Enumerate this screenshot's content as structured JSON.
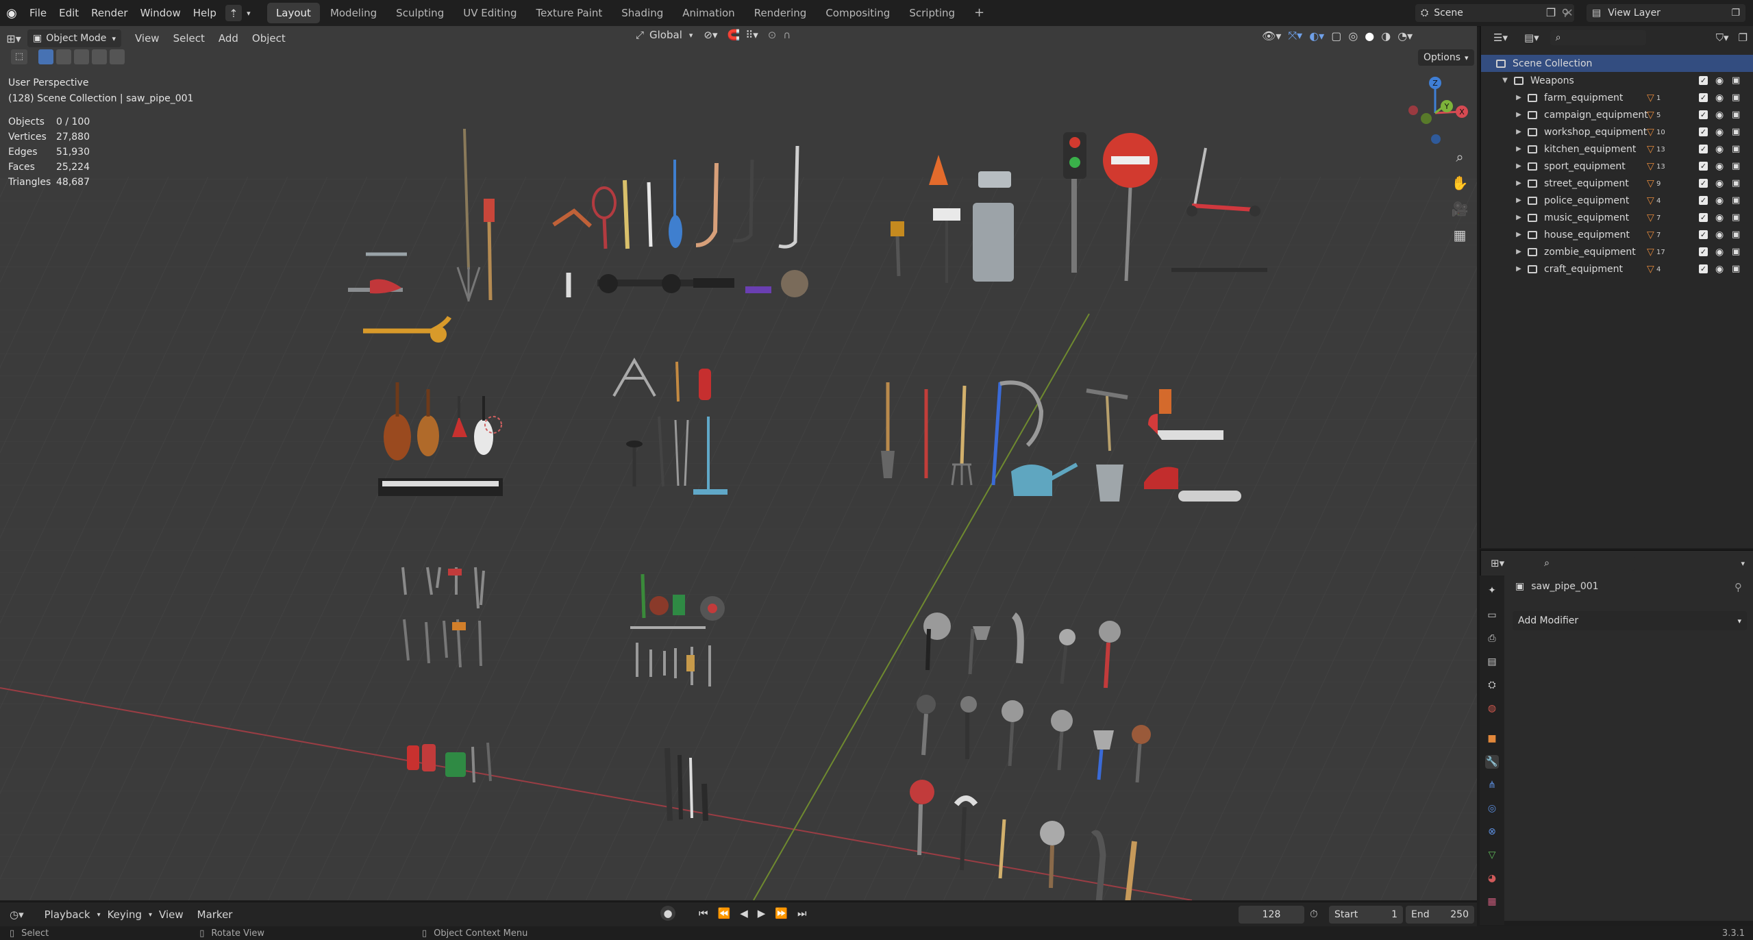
{
  "topbar": {
    "menus": [
      "File",
      "Edit",
      "Render",
      "Window",
      "Help"
    ],
    "workspaces": [
      "Layout",
      "Modeling",
      "Sculpting",
      "UV Editing",
      "Texture Paint",
      "Shading",
      "Animation",
      "Rendering",
      "Compositing",
      "Scripting"
    ],
    "active_workspace": "Layout",
    "add_workspace": "+",
    "scene": "Scene",
    "view_layer": "View Layer"
  },
  "viewport": {
    "mode": "Object Mode",
    "menus": [
      "View",
      "Select",
      "Add",
      "Object"
    ],
    "transform_orientation": "Global",
    "options_label": "Options",
    "perspective_label": "User Perspective",
    "collection_label": "(128) Scene Collection | saw_pipe_001",
    "stats": [
      {
        "label": "Objects",
        "value": "0 / 100"
      },
      {
        "label": "Vertices",
        "value": "27,880"
      },
      {
        "label": "Edges",
        "value": "51,930"
      },
      {
        "label": "Faces",
        "value": "25,224"
      },
      {
        "label": "Triangles",
        "value": "48,687"
      }
    ],
    "gizmo_axes": {
      "x": "X",
      "y": "Y",
      "z": "Z"
    },
    "colors": {
      "bg": "#3b3b3b",
      "grid": "#444444",
      "x_axis": "#b8474f",
      "y_axis": "#84a33a"
    }
  },
  "outliner": {
    "root": "Scene Collection",
    "collection": "Weapons",
    "items": [
      {
        "name": "farm_equipment",
        "count": "1"
      },
      {
        "name": "campaign_equipment",
        "count": "5"
      },
      {
        "name": "workshop_equipment",
        "count": "10"
      },
      {
        "name": "kitchen_equipment",
        "count": "13"
      },
      {
        "name": "sport_equipment",
        "count": "13"
      },
      {
        "name": "street_equipment",
        "count": "9"
      },
      {
        "name": "police_equipment",
        "count": "4"
      },
      {
        "name": "music_equipment",
        "count": "7"
      },
      {
        "name": "house_equipment",
        "count": "7"
      },
      {
        "name": "zombie_equipment",
        "count": "17"
      },
      {
        "name": "craft_equipment",
        "count": "4"
      }
    ]
  },
  "properties": {
    "object_name": "saw_pipe_001",
    "add_modifier": "Add Modifier"
  },
  "timeline": {
    "menus": [
      "Playback",
      "Keying",
      "View",
      "Marker"
    ],
    "current_frame": "128",
    "start_label": "Start",
    "start": "1",
    "end_label": "End",
    "end": "250"
  },
  "statusbar": {
    "select": "Select",
    "rotate": "Rotate View",
    "context_menu": "Object Context Menu",
    "version": "3.3.1"
  }
}
